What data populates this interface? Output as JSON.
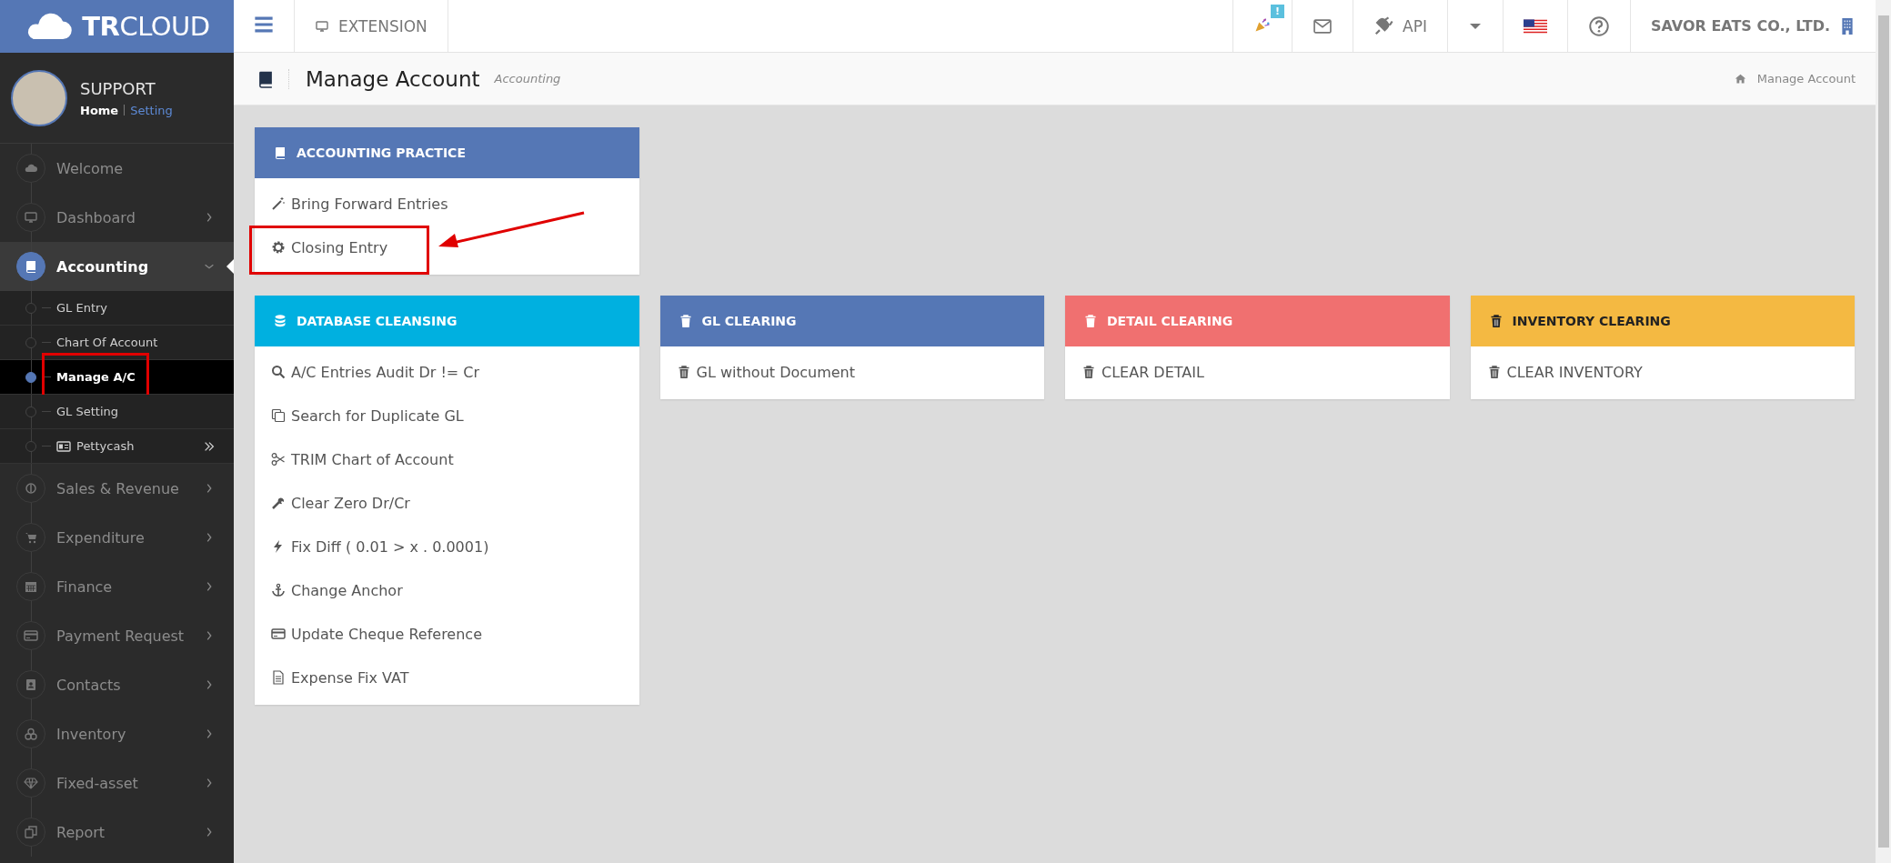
{
  "brand": {
    "logo_text": "**TR**CLOUD"
  },
  "topbar": {
    "extension": "EXTENSION",
    "notification_badge": "!",
    "api": "API",
    "company": "SAVOR EATS CO., LTD."
  },
  "profile": {
    "name": "SUPPORT",
    "links": [
      {
        "label": "Home",
        "selected": true
      },
      {
        "label": "Setting",
        "selected": false
      }
    ]
  },
  "sidebar": {
    "items": [
      {
        "label": "Welcome",
        "kind": "link",
        "selected": false,
        "expanded": false
      },
      {
        "label": "Dashboard",
        "kind": "menu",
        "selected": false,
        "expanded": false
      },
      {
        "label": "Accounting",
        "kind": "menu",
        "selected": true,
        "expanded": true,
        "children": [
          {
            "label": "GL Entry",
            "kind": "link",
            "selected": false,
            "highlighted": false
          },
          {
            "label": "Chart Of Account",
            "kind": "link",
            "selected": false,
            "highlighted": false
          },
          {
            "label": "Manage A/C",
            "kind": "link",
            "selected": true,
            "highlighted": true
          },
          {
            "label": "GL Setting",
            "kind": "link",
            "selected": false,
            "highlighted": false
          },
          {
            "label": "Pettycash",
            "kind": "submenu",
            "selected": false,
            "highlighted": false
          }
        ]
      },
      {
        "label": "Sales & Revenue",
        "kind": "menu",
        "selected": false,
        "expanded": false
      },
      {
        "label": "Expenditure",
        "kind": "menu",
        "selected": false,
        "expanded": false
      },
      {
        "label": "Finance",
        "kind": "menu",
        "selected": false,
        "expanded": false
      },
      {
        "label": "Payment Request",
        "kind": "menu",
        "selected": false,
        "expanded": false
      },
      {
        "label": "Contacts",
        "kind": "menu",
        "selected": false,
        "expanded": false
      },
      {
        "label": "Inventory",
        "kind": "menu",
        "selected": false,
        "expanded": false
      },
      {
        "label": "Fixed-asset",
        "kind": "menu",
        "selected": false,
        "expanded": false
      },
      {
        "label": "Report",
        "kind": "menu",
        "selected": false,
        "expanded": false
      }
    ]
  },
  "page_header": {
    "title": "Manage Account",
    "subtitle": "Accounting",
    "breadcrumb": "Manage Account"
  },
  "panel_rows": [
    [
      {
        "title": "ACCOUNTING PRACTICE",
        "color": "#5577b5",
        "items": [
          {
            "label": "Bring Forward Entries",
            "highlighted": false,
            "arrow": false
          },
          {
            "label": "Closing Entry",
            "highlighted": true,
            "arrow": true
          }
        ]
      }
    ],
    [
      {
        "title": "DATABASE CLEANSING",
        "color": "#00b0e0",
        "items": [
          {
            "label": "A/C Entries Audit Dr != Cr",
            "highlighted": false,
            "arrow": false
          },
          {
            "label": "Search for Duplicate GL",
            "highlighted": false,
            "arrow": false
          },
          {
            "label": "TRIM Chart of Account",
            "highlighted": false,
            "arrow": false
          },
          {
            "label": "Clear Zero Dr/Cr",
            "highlighted": false,
            "arrow": false
          },
          {
            "label": "Fix Diff ( 0.01 > x . 0.0001)",
            "highlighted": false,
            "arrow": false
          },
          {
            "label": "Change Anchor",
            "highlighted": false,
            "arrow": false
          },
          {
            "label": "Update Cheque Reference",
            "highlighted": false,
            "arrow": false
          },
          {
            "label": "Expense Fix VAT",
            "highlighted": false,
            "arrow": false
          }
        ]
      },
      {
        "title": "GL CLEARING",
        "color": "#5577b5",
        "items": [
          {
            "label": "GL without Document",
            "highlighted": false,
            "arrow": false
          }
        ]
      },
      {
        "title": "DETAIL CLEARING",
        "color": "#f07070",
        "items": [
          {
            "label": "CLEAR DETAIL",
            "highlighted": false,
            "arrow": false
          }
        ]
      },
      {
        "title": "INVENTORY CLEARING",
        "color": "#f4b942",
        "items": [
          {
            "label": "CLEAR INVENTORY",
            "highlighted": false,
            "arrow": false
          }
        ]
      }
    ]
  ]
}
